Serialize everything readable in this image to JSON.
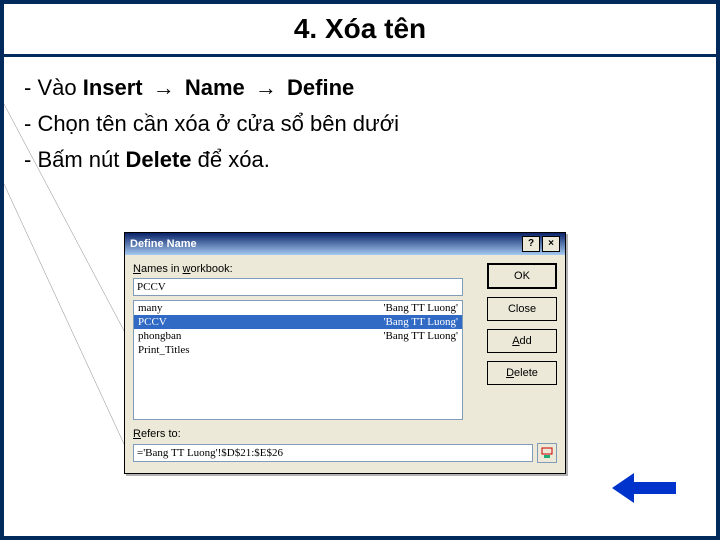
{
  "title": "4. Xóa tên",
  "steps": {
    "s1_prefix": "- Vào ",
    "s1_ins": "Insert",
    "s1_arr1": "→",
    "s1_name": "Name",
    "s1_arr2": "→",
    "s1_define": "Define",
    "s2": "- Chọn tên cần xóa ở cửa sổ bên dưới",
    "s3_prefix": "- Bấm nút ",
    "s3_del": "Delete",
    "s3_suffix": "  để xóa."
  },
  "dialog": {
    "title": "Define Name",
    "help": "?",
    "close": "×",
    "names_label": "Names in workbook:",
    "input_value": "PCCV",
    "rows": [
      {
        "name": "many",
        "ref": "'Bang TT Luong'"
      },
      {
        "name": "PCCV",
        "ref": "'Bang TT Luong'",
        "selected": true
      },
      {
        "name": "phongban",
        "ref": "'Bang TT Luong'"
      },
      {
        "name": "Print_Titles",
        "ref": ""
      }
    ],
    "buttons": {
      "ok": "OK",
      "close_b": "Close",
      "add": "Add",
      "add_u": "A",
      "delete": "Delete",
      "delete_u": "D"
    },
    "refers_label": "Refers to:",
    "refers_label_u": "R",
    "refers_value": "='Bang TT Luong'!$D$21:$E$26"
  }
}
